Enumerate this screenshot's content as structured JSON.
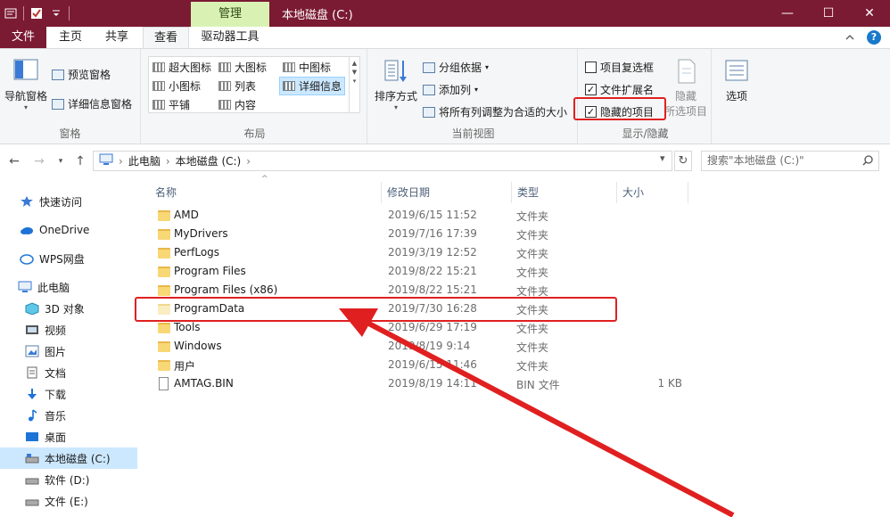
{
  "window": {
    "title": "本地磁盘 (C:)",
    "contextual_tab": "管理",
    "controls": {
      "minimize": "—",
      "maximize": "☐",
      "close": "✕"
    }
  },
  "ribbon_tabs": [
    "文件",
    "主页",
    "共享",
    "查看",
    "驱动器工具"
  ],
  "ribbon": {
    "panes": {
      "label": "窗格",
      "nav_pane": "导航窗格",
      "preview_pane": "预览窗格",
      "details_pane": "详细信息窗格"
    },
    "layout": {
      "label": "布局",
      "options": [
        "超大图标",
        "大图标",
        "中图标",
        "小图标",
        "列表",
        "详细信息",
        "平铺",
        "内容"
      ],
      "selected": "详细信息"
    },
    "current_view": {
      "label": "当前视图",
      "sort_by": "排序方式",
      "group_by": "分组依据",
      "add_column": "添加列",
      "fit_columns": "将所有列调整为合适的大小"
    },
    "show_hide": {
      "label": "显示/隐藏",
      "item_checkboxes": {
        "label": "项目复选框",
        "checked": false
      },
      "file_extensions": {
        "label": "文件扩展名",
        "checked": true
      },
      "hidden_items": {
        "label": "隐藏的项目",
        "checked": true
      },
      "hide_selected": "隐藏",
      "hide_selected_2": "所选项目"
    },
    "options": "选项"
  },
  "address": {
    "crumbs": [
      "此电脑",
      "本地磁盘 (C:)"
    ],
    "separator": "›",
    "search_placeholder": "搜索\"本地磁盘 (C:)\""
  },
  "nav_pane": {
    "items": [
      {
        "label": "快速访问",
        "icon": "star-icon"
      },
      {
        "label": "OneDrive",
        "icon": "cloud-icon"
      },
      {
        "label": "WPS网盘",
        "icon": "wps-cloud-icon"
      },
      {
        "label": "此电脑",
        "icon": "computer-icon"
      },
      {
        "label": "3D 对象",
        "icon": "cube-icon"
      },
      {
        "label": "视频",
        "icon": "video-icon"
      },
      {
        "label": "图片",
        "icon": "picture-icon"
      },
      {
        "label": "文档",
        "icon": "document-icon"
      },
      {
        "label": "下载",
        "icon": "download-icon"
      },
      {
        "label": "音乐",
        "icon": "music-icon"
      },
      {
        "label": "桌面",
        "icon": "desktop-icon"
      },
      {
        "label": "本地磁盘 (C:)",
        "icon": "drive-icon"
      },
      {
        "label": "软件 (D:)",
        "icon": "drive-icon"
      },
      {
        "label": "文件 (E:)",
        "icon": "drive-icon"
      }
    ],
    "selected": "本地磁盘 (C:)"
  },
  "file_list": {
    "columns": [
      "名称",
      "修改日期",
      "类型",
      "大小"
    ],
    "rows": [
      {
        "name": "AMD",
        "date": "2019/6/15 11:52",
        "type": "文件夹",
        "size": ""
      },
      {
        "name": "MyDrivers",
        "date": "2019/7/16 17:39",
        "type": "文件夹",
        "size": ""
      },
      {
        "name": "PerfLogs",
        "date": "2019/3/19 12:52",
        "type": "文件夹",
        "size": ""
      },
      {
        "name": "Program Files",
        "date": "2019/8/22 15:21",
        "type": "文件夹",
        "size": ""
      },
      {
        "name": "Program Files (x86)",
        "date": "2019/8/22 15:21",
        "type": "文件夹",
        "size": ""
      },
      {
        "name": "ProgramData",
        "date": "2019/7/30 16:28",
        "type": "文件夹",
        "size": ""
      },
      {
        "name": "Tools",
        "date": "2019/6/29 17:19",
        "type": "文件夹",
        "size": ""
      },
      {
        "name": "Windows",
        "date": "2019/8/19 9:14",
        "type": "文件夹",
        "size": ""
      },
      {
        "name": "用户",
        "date": "2019/6/15 11:46",
        "type": "文件夹",
        "size": ""
      },
      {
        "name": "AMTAG.BIN",
        "date": "2019/8/19 14:11",
        "type": "BIN 文件",
        "size": "1 KB"
      }
    ],
    "highlighted_row": "ProgramData"
  },
  "colors": {
    "titlebar": "#7b1a33",
    "manage_tab": "#d9f2b4",
    "annotation_red": "#e02020",
    "selection": "#cce8ff"
  }
}
